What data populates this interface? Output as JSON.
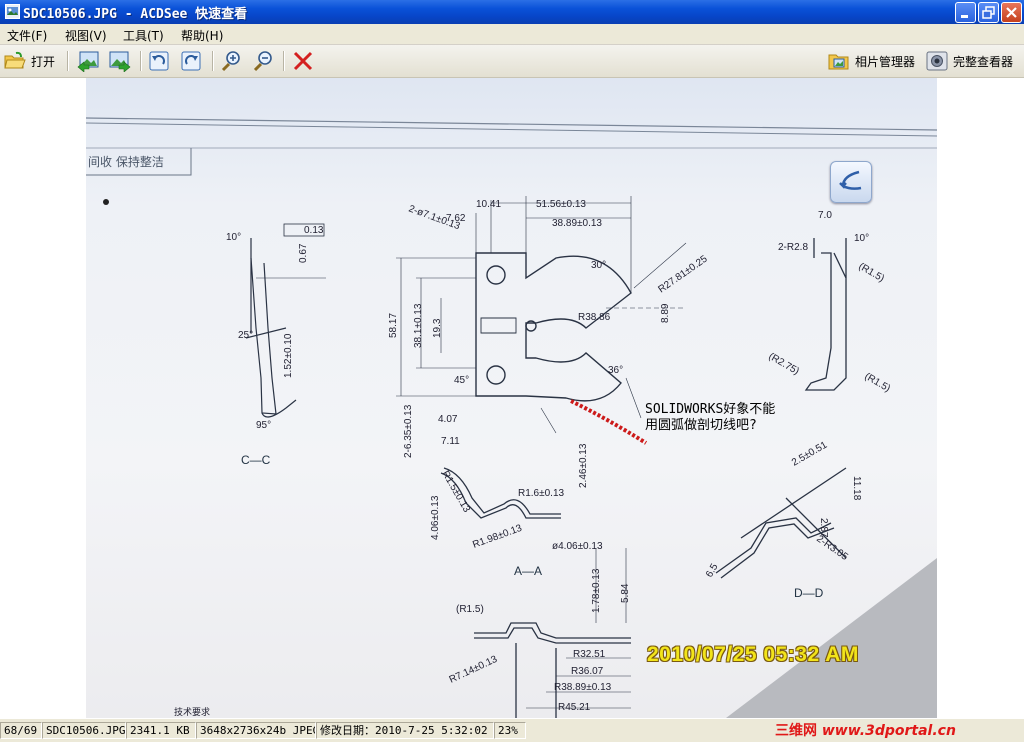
{
  "window": {
    "title": "SDC10506.JPG - ACDSee 快速查看",
    "controls": {
      "minimize": "minimize-icon",
      "restore": "restore-icon",
      "close": "close-icon"
    }
  },
  "menu": [
    {
      "label": "文件(F)"
    },
    {
      "label": "视图(V)"
    },
    {
      "label": "工具(T)"
    },
    {
      "label": "帮助(H)"
    }
  ],
  "toolbar": {
    "open_label": "打开",
    "photo_manager_label": "相片管理器",
    "full_viewer_label": "完整查看器",
    "icons": [
      "open-folder-icon",
      "previous-image-icon",
      "next-image-icon",
      "rotate-left-icon",
      "rotate-right-icon",
      "zoom-in-icon",
      "zoom-out-icon",
      "delete-icon"
    ]
  },
  "image": {
    "header_text": "间收  保持整洁",
    "annotation": "SOLIDWORKS好象不能用圆弧做剖切线吧?",
    "timestamp_stamp": "2010/07/25 05:32 AM",
    "section_labels": [
      "C—C",
      "A—A",
      "D—D"
    ],
    "dimensions": {
      "d1": "51.56±0.13",
      "d2": "38.89±0.13",
      "d3": "10.41",
      "d4": "7.62",
      "d5": "2-ø7.1±0.13",
      "d6": "R38.86",
      "d7": "R27.81±0.25",
      "d8": "8.89",
      "d9": "58.17",
      "d10": "38.1±0.13",
      "d11": "19.3",
      "d12": "4.07",
      "d13": "7.11",
      "d14": "2-6.35±0.13",
      "d15": "R1.6±0.13",
      "d16": "2.46±0.13",
      "d17": "ø4.06±0.13",
      "d18": "R1.98±0.13",
      "d19": "R1.5±0.13",
      "d20": "4.06±0.13",
      "d21": "2.5±0.51",
      "d22": "11.18",
      "d23": "2.87",
      "d24": "2-R3.05",
      "d25": "1.78±0.13",
      "d26": "5.84",
      "d27": "R32.51",
      "d28": "R36.07",
      "d29": "R38.89±0.13",
      "d30": "R45.21",
      "d31": "R7.14±0.13",
      "d32": "(R1.5)",
      "d33": "2-R2.8",
      "d34": "(R1.5)",
      "d35": "(R2.75)",
      "d36": "(R1.5)",
      "d37": "0.13",
      "d38": "0.67",
      "d39": "1.52±0.10",
      "d40": "10°",
      "d41": "10°",
      "d42": "30°",
      "d43": "36°",
      "d44": "45°",
      "d45": "25°",
      "d46": "95°",
      "d47": "7.0",
      "d48": "6.5",
      "d49": "技术要求"
    }
  },
  "statusbar": {
    "index": "68/69",
    "filename": "SDC10506.JPG",
    "filesize": "2341.1 KB",
    "dimensions": "3648x2736x24b JPEG",
    "modified": "修改日期：2010-7-25 5:32:02",
    "zoom": "23%"
  },
  "watermark": {
    "cn": "三维网",
    "url": "www.3dportal.cn"
  },
  "colors": {
    "titlebar": "#0a52d8",
    "chrome": "#ece9d8",
    "annotation_mark": "#cc1a1a",
    "stamp": "#f2e41a"
  }
}
